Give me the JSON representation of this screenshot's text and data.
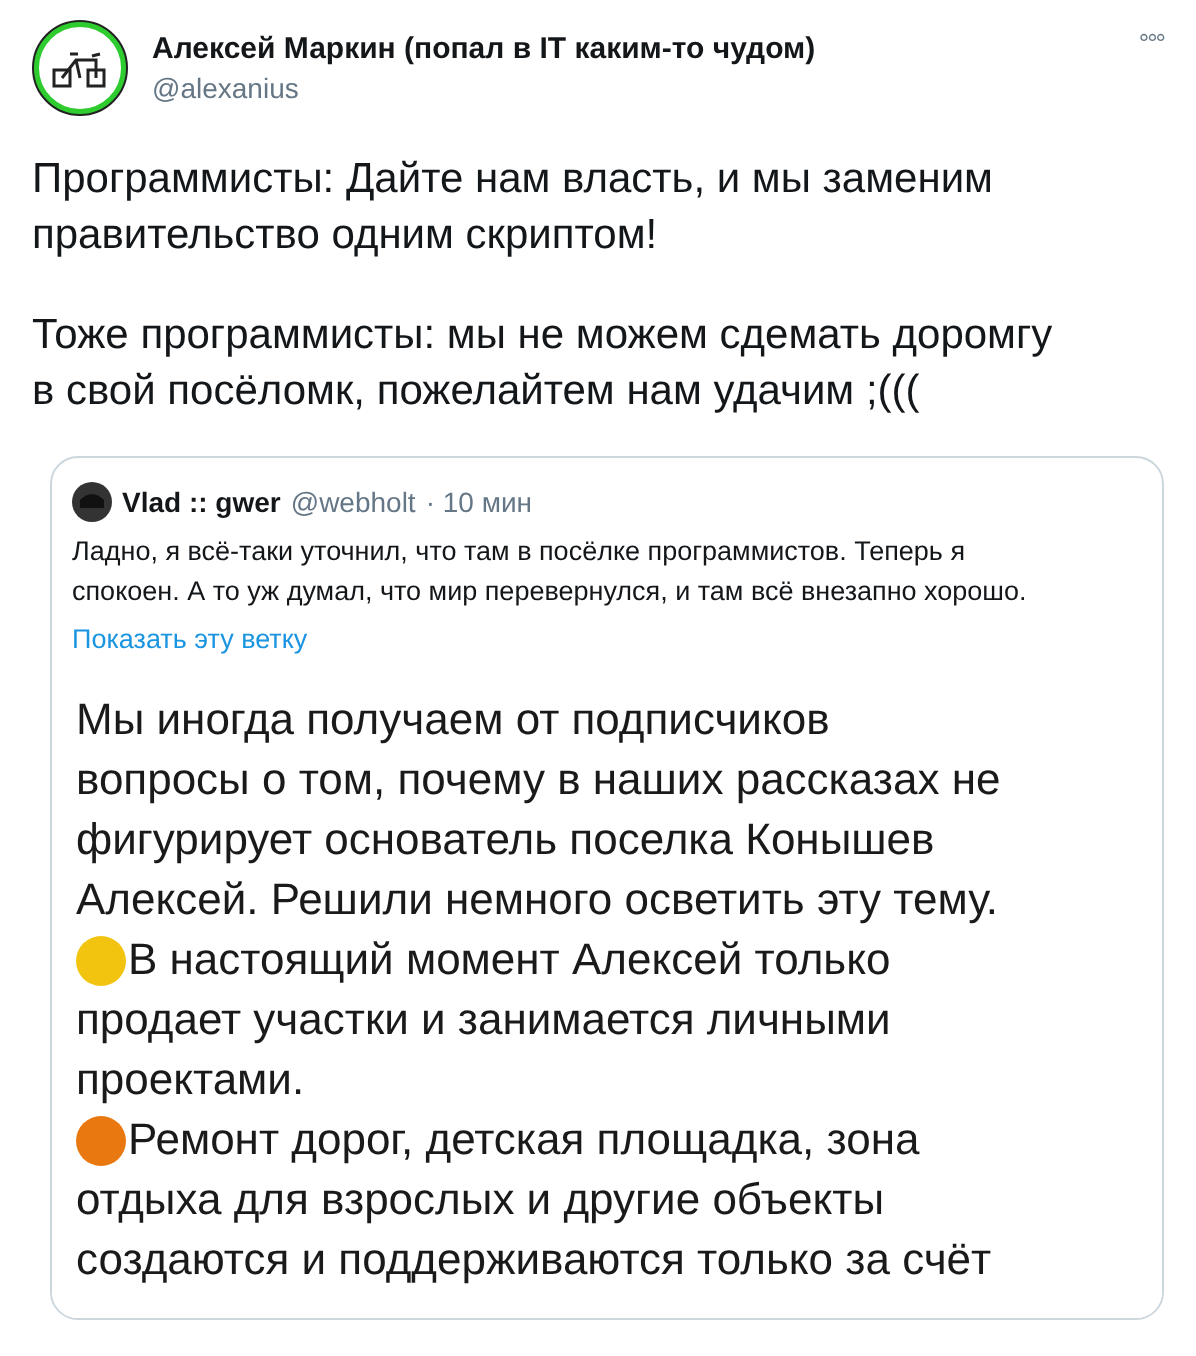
{
  "tweet": {
    "author": {
      "name": "Алексей Маркин (попал в IT каким-то чудом)",
      "handle": "@alexanius"
    },
    "more": "°°°",
    "paragraphs": [
      "Программисты: Дайте нам власть, и мы заменим\nправительство одним скриптом!",
      "Тоже программисты: мы не можем сдемать доромгу\nв свой посёломк, пожелайтем нам удачим ;((("
    ],
    "quote": {
      "author": {
        "name": "Vlad :: gwer",
        "handle": "@webholt",
        "time": "· 10 мин"
      },
      "text": "Ладно, я всё-таки уточнил, что там в посёлке программистов. Теперь я\nспокоен. А то уж думал, что мир перевернулся, и там всё внезапно хорошо.",
      "thread_link": "Показать эту ветку",
      "image": {
        "blocks": [
          {
            "kind": "text",
            "text": "Мы иногда получаем от подписчиков\nвопросы о том, почему в наших рассказах не\nфигурирует основатель поселка Конышев\nАлексей. Решили немного осветить эту тему."
          },
          {
            "kind": "bullet",
            "color": "#f2c40f",
            "text": "В настоящий момент Алексей только\nпродает участки и занимается личными\nпроектами."
          },
          {
            "kind": "bullet",
            "color": "#e8780f",
            "text": "Ремонт дорог, детская площадка, зона\nотдыха для взрослых и другие объекты\nсоздаются и поддерживаются только за счёт"
          }
        ]
      }
    }
  }
}
